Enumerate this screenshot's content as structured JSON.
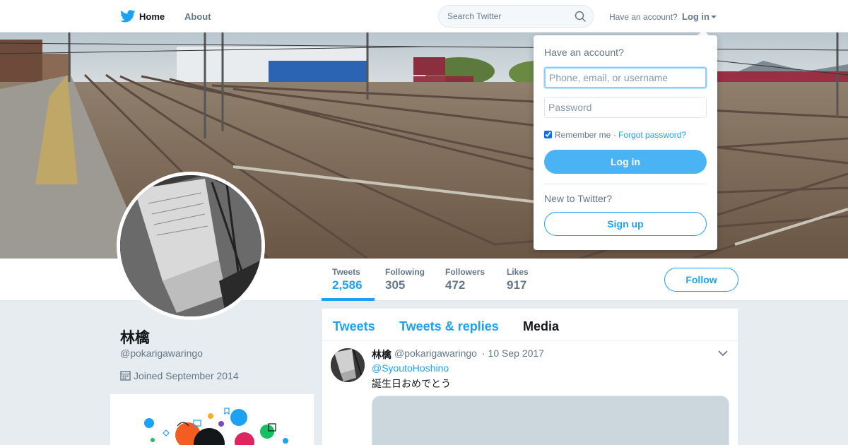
{
  "colors": {
    "accent": "#1da1f2",
    "background": "#e6ecf0",
    "text": "#14171a",
    "muted": "#657786"
  },
  "nav": {
    "home_label": "Home",
    "about_label": "About",
    "search_placeholder": "Search Twitter",
    "have_account": "Have an account?",
    "login_label": "Log in",
    "icons": {
      "logo": "twitter-bird-icon",
      "home": "home-icon",
      "search": "search-icon",
      "caret": "caret-down-icon"
    }
  },
  "profile": {
    "name": "林檎",
    "handle": "@pokarigawaringo",
    "joined": "Joined September 2014"
  },
  "stats": [
    {
      "label": "Tweets",
      "value": "2,586",
      "active": true
    },
    {
      "label": "Following",
      "value": "305",
      "active": false
    },
    {
      "label": "Followers",
      "value": "472",
      "active": false
    },
    {
      "label": "Likes",
      "value": "917",
      "active": false
    }
  ],
  "follow_label": "Follow",
  "timeline": {
    "tabs": [
      {
        "label": "Tweets"
      },
      {
        "label": "Tweets & replies"
      },
      {
        "label": "Media"
      }
    ],
    "tweet": {
      "name": "林檎",
      "handle": "@pokarigawaringo",
      "date": "· 10 Sep 2017",
      "mention": "@SyoutoHoshino",
      "text": "誕生日おめでとう"
    }
  },
  "login_dropdown": {
    "title": "Have an account?",
    "username_placeholder": "Phone, email, or username",
    "password_placeholder": "Password",
    "remember_label": "Remember me",
    "separator": " · ",
    "forgot_label": "Forgot password?",
    "login_button": "Log in",
    "new_label": "New to Twitter?",
    "signup_button": "Sign up"
  }
}
